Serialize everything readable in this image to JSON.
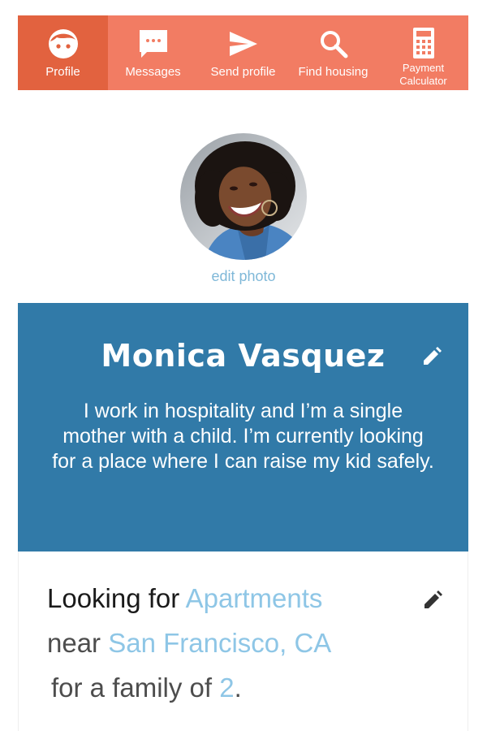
{
  "nav": {
    "items": [
      {
        "label": "Profile",
        "icon": "face-icon",
        "active": true
      },
      {
        "label": "Messages",
        "icon": "chat-bubble-icon",
        "active": false
      },
      {
        "label": "Send profile",
        "icon": "send-icon",
        "active": false
      },
      {
        "label": "Find housing",
        "icon": "search-icon",
        "active": false
      },
      {
        "label": "Payment Calculator",
        "icon": "calculator-icon",
        "active": false
      }
    ]
  },
  "profile": {
    "photo_edit_label": "edit photo",
    "name": "Monica Vasquez",
    "bio": "I work in hospitality and I’m a single mother with a child. I’m currently looking for a place where I can raise my kid safely.",
    "edit_icon": "pencil-icon"
  },
  "looking": {
    "prefix": "Looking for ",
    "housing_type": "Apartments",
    "near_label": "near ",
    "location": "San Francisco, CA",
    "family_label": "for a family of ",
    "family_size": "2",
    "suffix": ".",
    "edit_icon": "pencil-icon"
  },
  "colors": {
    "nav_bg": "#f27c63",
    "nav_active_bg": "#e2623f",
    "card_bg": "#317aa8",
    "link": "#8ec6e6"
  }
}
